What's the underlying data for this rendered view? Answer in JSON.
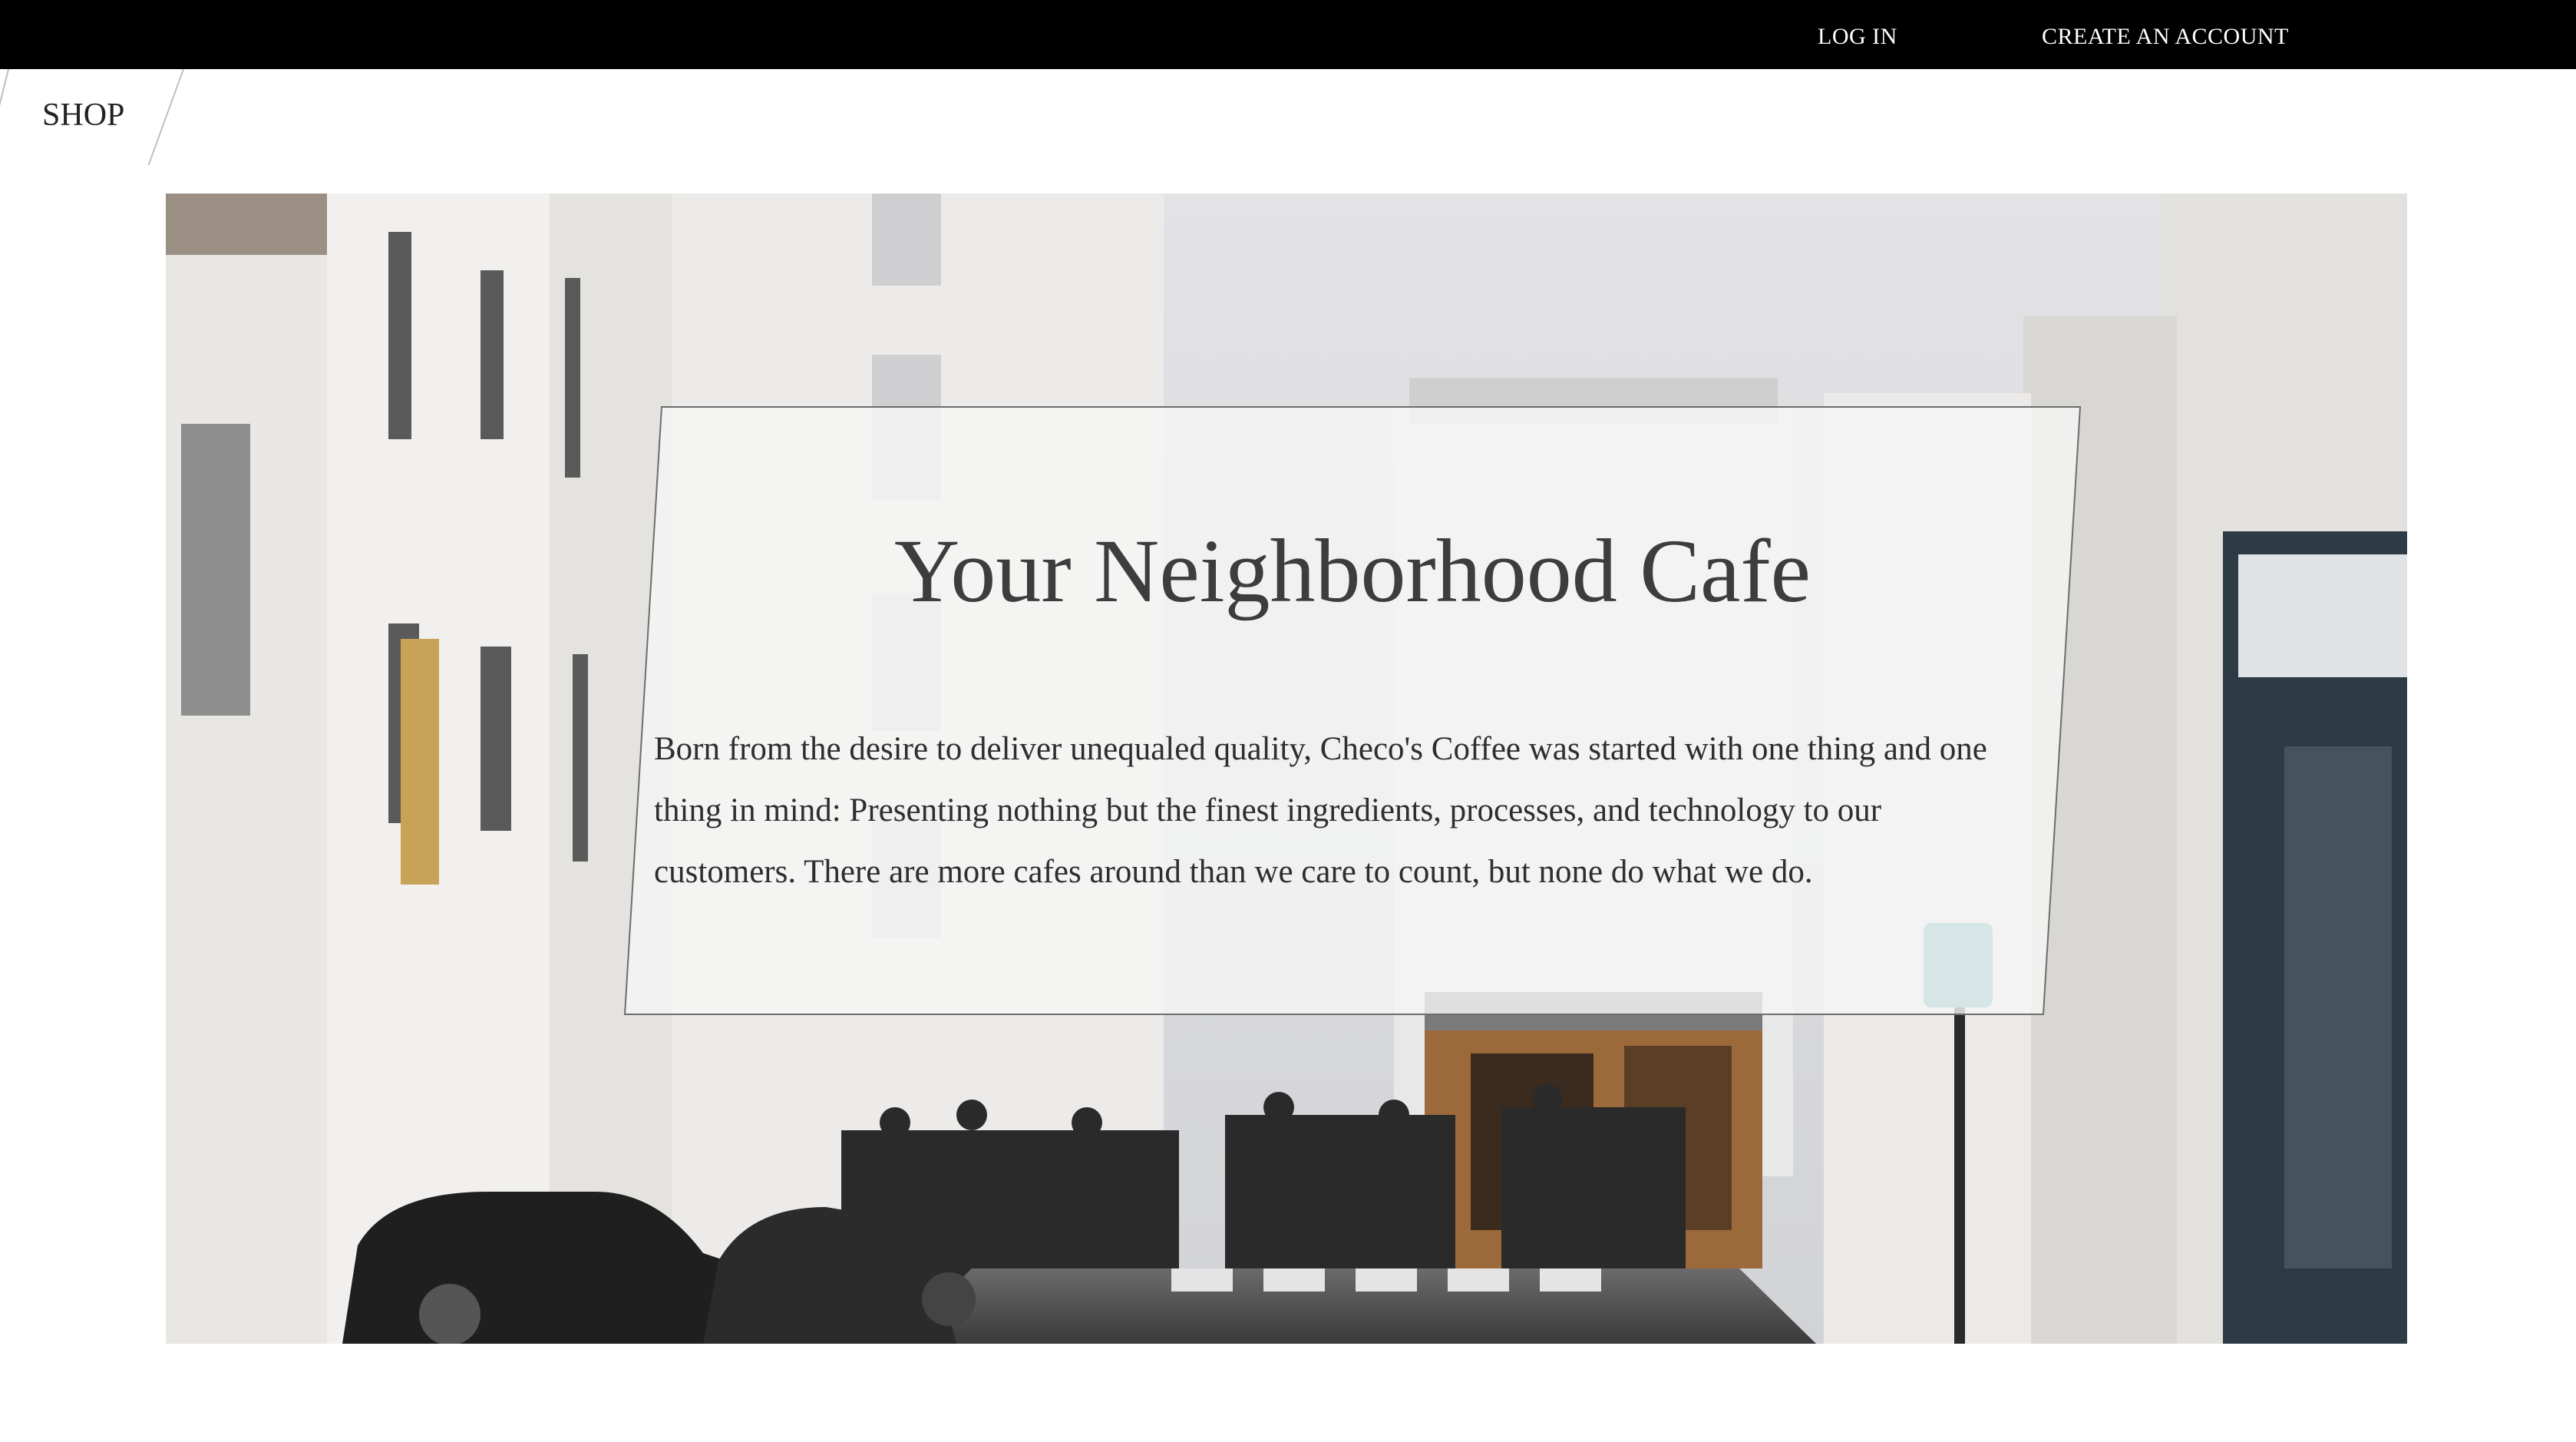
{
  "topbar": {
    "login_label": "LOG IN",
    "signup_label": "CREATE AN ACCOUNT"
  },
  "nav": {
    "shop_label": "SHOP"
  },
  "hero": {
    "image_alt": "street scene with cafe",
    "headline": "Your Neighborhood Cafe",
    "body": "Born from the desire to deliver unequaled quality, Checo's Coffee was started with one thing and one thing in mind: Presenting nothing but the finest ingredients, processes, and technology to our customers. There are more cafes around than we care to count, but none do what we do."
  },
  "colors": {
    "topbar_bg": "#000000",
    "topbar_text": "#ffffff",
    "headline": "#3d3d3d",
    "panel_bg": "rgba(245,245,245,0.82)"
  }
}
